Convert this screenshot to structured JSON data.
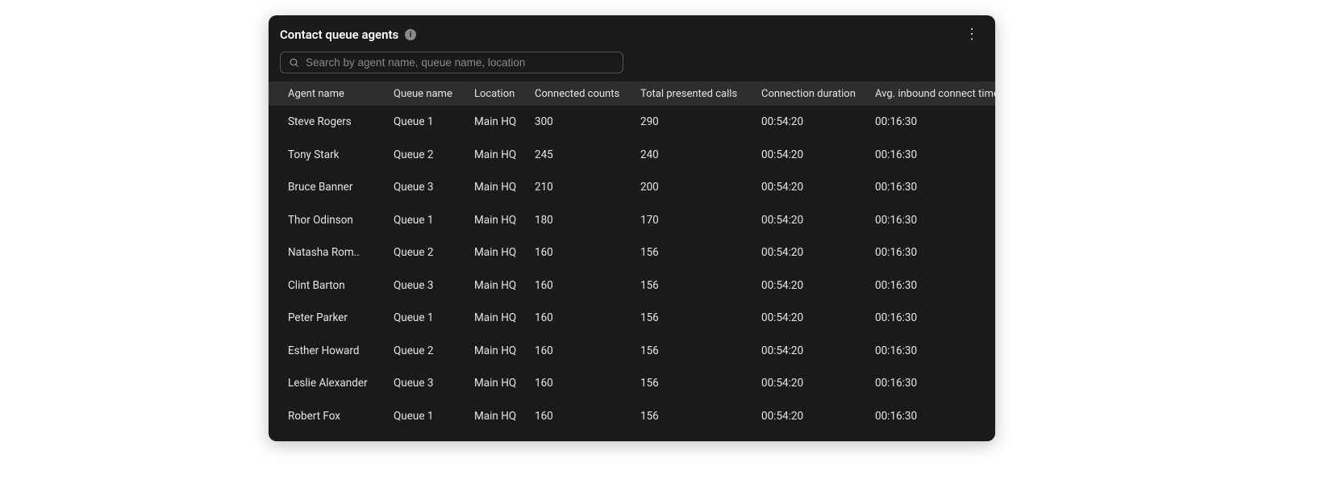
{
  "header": {
    "title": "Contact queue agents"
  },
  "search": {
    "placeholder": "Search by agent name, queue name, location"
  },
  "columns": [
    "Agent name",
    "Queue name",
    "Location",
    "Connected counts",
    "Total presented calls",
    "Connection duration",
    "Avg. inbound connect time"
  ],
  "rows": [
    {
      "agent": "Steve Rogers",
      "queue": "Queue 1",
      "location": "Main HQ",
      "connected": "300",
      "total": "290",
      "duration": "00:54:20",
      "avg": "00:16:30"
    },
    {
      "agent": "Tony Stark",
      "queue": "Queue 2",
      "location": "Main HQ",
      "connected": "245",
      "total": "240",
      "duration": "00:54:20",
      "avg": "00:16:30"
    },
    {
      "agent": "Bruce Banner",
      "queue": "Queue 3",
      "location": "Main HQ",
      "connected": "210",
      "total": "200",
      "duration": "00:54:20",
      "avg": "00:16:30"
    },
    {
      "agent": "Thor Odinson",
      "queue": "Queue 1",
      "location": "Main HQ",
      "connected": "180",
      "total": "170",
      "duration": "00:54:20",
      "avg": "00:16:30"
    },
    {
      "agent": "Natasha Rom..",
      "queue": "Queue 2",
      "location": "Main HQ",
      "connected": "160",
      "total": "156",
      "duration": "00:54:20",
      "avg": "00:16:30"
    },
    {
      "agent": "Clint Barton",
      "queue": "Queue 3",
      "location": "Main HQ",
      "connected": "160",
      "total": "156",
      "duration": "00:54:20",
      "avg": "00:16:30"
    },
    {
      "agent": "Peter Parker",
      "queue": "Queue 1",
      "location": "Main HQ",
      "connected": "160",
      "total": "156",
      "duration": "00:54:20",
      "avg": "00:16:30"
    },
    {
      "agent": "Esther Howard",
      "queue": "Queue 2",
      "location": "Main HQ",
      "connected": "160",
      "total": "156",
      "duration": "00:54:20",
      "avg": "00:16:30"
    },
    {
      "agent": "Leslie Alexander",
      "queue": "Queue 3",
      "location": "Main HQ",
      "connected": "160",
      "total": "156",
      "duration": "00:54:20",
      "avg": "00:16:30"
    },
    {
      "agent": "Robert Fox",
      "queue": "Queue 1",
      "location": "Main HQ",
      "connected": "160",
      "total": "156",
      "duration": "00:54:20",
      "avg": "00:16:30"
    }
  ]
}
